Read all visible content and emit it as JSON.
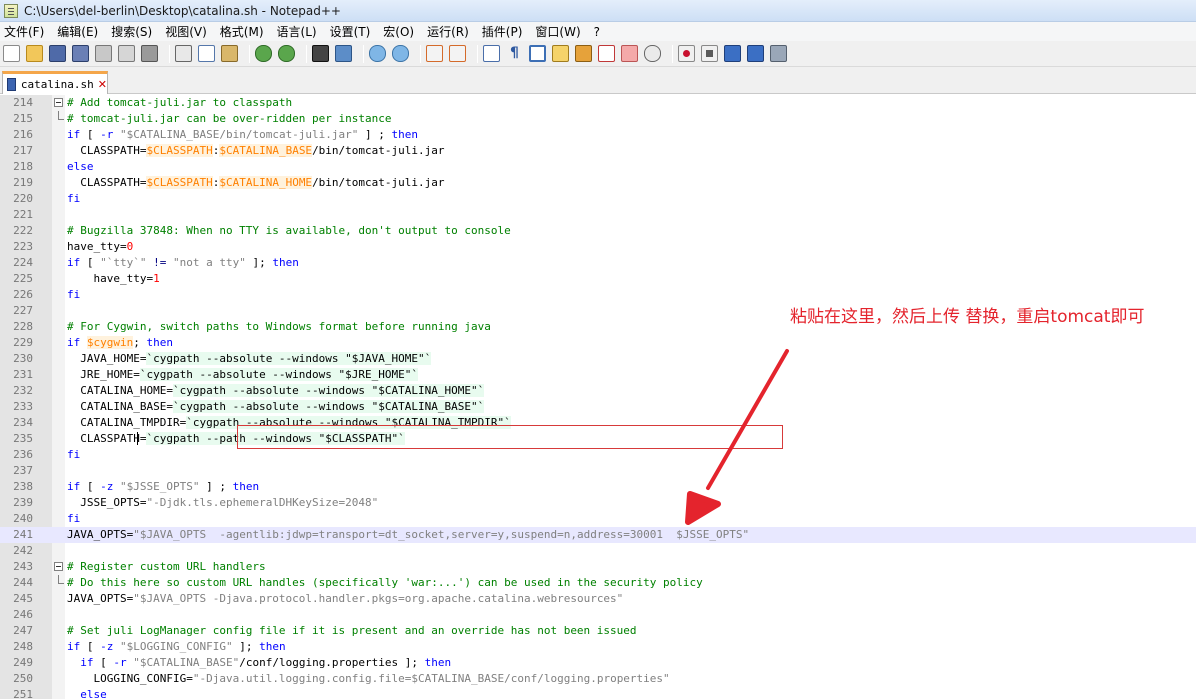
{
  "window": {
    "title": "C:\\Users\\del-berlin\\Desktop\\catalina.sh - Notepad++"
  },
  "menu": [
    "文件(F)",
    "编辑(E)",
    "搜索(S)",
    "视图(V)",
    "格式(M)",
    "语言(L)",
    "设置(T)",
    "宏(O)",
    "运行(R)",
    "插件(P)",
    "窗口(W)",
    "?"
  ],
  "toolbar_icons": [
    "new-file",
    "open-folder",
    "save",
    "save-all",
    "close",
    "close-all",
    "print",
    "|",
    "cut",
    "copy",
    "paste",
    "|",
    "undo",
    "redo",
    "|",
    "find",
    "replace",
    "|",
    "zoom-in",
    "zoom-out",
    "|",
    "sync-v",
    "sync-h",
    "|",
    "wrap",
    "all-chars",
    "indent-guide",
    "lang",
    "doc-map",
    "func-list",
    "folder",
    "monitor",
    "|",
    "rec",
    "stop",
    "play",
    "play-multi",
    "save-macro"
  ],
  "tabs": [
    {
      "label": "catalina.sh",
      "active": true
    }
  ],
  "editor": {
    "caret_line": 241,
    "lines": [
      {
        "n": "214",
        "fold": "start",
        "tokens": [
          [
            "c",
            "# Add tomcat-juli.jar to classpath"
          ]
        ]
      },
      {
        "n": "215",
        "fold": "end",
        "tokens": [
          [
            "c",
            "# tomcat-juli.jar can be over-ridden per instance"
          ]
        ]
      },
      {
        "n": "216",
        "tokens": [
          [
            "k",
            "if"
          ],
          [
            "t",
            " [ "
          ],
          [
            "k",
            "-r"
          ],
          [
            "t",
            " "
          ],
          [
            "s",
            "\"$CATALINA_BASE/bin/tomcat-juli.jar\""
          ],
          [
            "t",
            " ] ; "
          ],
          [
            "k",
            "then"
          ]
        ]
      },
      {
        "n": "217",
        "tokens": [
          [
            "t",
            "  CLASSPATH="
          ],
          [
            "v",
            "$CLASSPATH"
          ],
          [
            "t",
            ":"
          ],
          [
            "v",
            "$CATALINA_BASE"
          ],
          [
            "t",
            "/bin/tomcat-juli.jar"
          ]
        ]
      },
      {
        "n": "218",
        "tokens": [
          [
            "k",
            "else"
          ]
        ]
      },
      {
        "n": "219",
        "tokens": [
          [
            "t",
            "  CLASSPATH="
          ],
          [
            "v",
            "$CLASSPATH"
          ],
          [
            "t",
            ":"
          ],
          [
            "v",
            "$CATALINA_HOME"
          ],
          [
            "t",
            "/bin/tomcat-juli.jar"
          ]
        ]
      },
      {
        "n": "220",
        "tokens": [
          [
            "k",
            "fi"
          ]
        ]
      },
      {
        "n": "221",
        "tokens": []
      },
      {
        "n": "222",
        "tokens": [
          [
            "c",
            "# Bugzilla 37848: When no TTY is available, don't output to console"
          ]
        ]
      },
      {
        "n": "223",
        "tokens": [
          [
            "t",
            "have_tty="
          ],
          [
            "n",
            "0"
          ]
        ]
      },
      {
        "n": "224",
        "tokens": [
          [
            "k",
            "if"
          ],
          [
            "t",
            " [ "
          ],
          [
            "s",
            "\"`tty`\""
          ],
          [
            "t",
            " "
          ],
          [
            "o",
            "!="
          ],
          [
            "t",
            " "
          ],
          [
            "s",
            "\"not a tty\""
          ],
          [
            "t",
            " ]; "
          ],
          [
            "k",
            "then"
          ]
        ]
      },
      {
        "n": "225",
        "tokens": [
          [
            "t",
            "    have_tty="
          ],
          [
            "n",
            "1"
          ]
        ]
      },
      {
        "n": "226",
        "tokens": [
          [
            "k",
            "fi"
          ]
        ]
      },
      {
        "n": "227",
        "tokens": []
      },
      {
        "n": "228",
        "tokens": [
          [
            "c",
            "# For Cygwin, switch paths to Windows format before running java"
          ]
        ]
      },
      {
        "n": "229",
        "tokens": [
          [
            "k",
            "if"
          ],
          [
            "t",
            " "
          ],
          [
            "v",
            "$cygwin"
          ],
          [
            "t",
            "; "
          ],
          [
            "k",
            "then"
          ]
        ]
      },
      {
        "n": "230",
        "tokens": [
          [
            "t",
            "  JAVA_HOME="
          ],
          [
            "b",
            "`cygpath --absolute --windows \"$JAVA_HOME\"`"
          ]
        ]
      },
      {
        "n": "231",
        "tokens": [
          [
            "t",
            "  JRE_HOME="
          ],
          [
            "b",
            "`cygpath --absolute --windows \"$JRE_HOME\"`"
          ]
        ]
      },
      {
        "n": "232",
        "tokens": [
          [
            "t",
            "  CATALINA_HOME="
          ],
          [
            "b",
            "`cygpath --absolute --windows \"$CATALINA_HOME\"`"
          ]
        ]
      },
      {
        "n": "233",
        "tokens": [
          [
            "t",
            "  CATALINA_BASE="
          ],
          [
            "b",
            "`cygpath --absolute --windows \"$CATALINA_BASE\"`"
          ]
        ]
      },
      {
        "n": "234",
        "tokens": [
          [
            "t",
            "  CATALINA_TMPDIR="
          ],
          [
            "b",
            "`cygpath --absolute --windows \"$CATALINA_TMPDIR\"`"
          ]
        ]
      },
      {
        "n": "235",
        "tokens": [
          [
            "t",
            "  CLASSPATH="
          ],
          [
            "b",
            "`cygpath --path --windows \"$CLASSPATH\"`"
          ]
        ]
      },
      {
        "n": "236",
        "tokens": [
          [
            "k",
            "fi"
          ]
        ]
      },
      {
        "n": "237",
        "tokens": []
      },
      {
        "n": "238",
        "tokens": [
          [
            "k",
            "if"
          ],
          [
            "t",
            " [ "
          ],
          [
            "k",
            "-z"
          ],
          [
            "t",
            " "
          ],
          [
            "s",
            "\"$JSSE_OPTS\""
          ],
          [
            "t",
            " ] ; "
          ],
          [
            "k",
            "then"
          ]
        ]
      },
      {
        "n": "239",
        "tokens": [
          [
            "t",
            "  JSSE_OPTS="
          ],
          [
            "s",
            "\"-Djdk.tls.ephemeralDHKeySize=2048\""
          ]
        ]
      },
      {
        "n": "240",
        "tokens": [
          [
            "k",
            "fi"
          ]
        ]
      },
      {
        "n": "241",
        "tokens": [
          [
            "t",
            "JAVA_OPTS="
          ],
          [
            "s",
            "\"$JAVA_OPTS  -agentlib:jdwp=transport=dt_socket,server=y,suspend=n,address=30001  $JSSE_OPTS\""
          ]
        ]
      },
      {
        "n": "242",
        "tokens": []
      },
      {
        "n": "243",
        "fold": "start",
        "tokens": [
          [
            "c",
            "# Register custom URL handlers"
          ]
        ]
      },
      {
        "n": "244",
        "fold": "end",
        "tokens": [
          [
            "c",
            "# Do this here so custom URL handles (specifically 'war:...') can be used in the security policy"
          ]
        ]
      },
      {
        "n": "245",
        "tokens": [
          [
            "t",
            "JAVA_OPTS="
          ],
          [
            "s",
            "\"$JAVA_OPTS -Djava.protocol.handler.pkgs=org.apache.catalina.webresources\""
          ]
        ]
      },
      {
        "n": "246",
        "tokens": []
      },
      {
        "n": "247",
        "tokens": [
          [
            "c",
            "# Set juli LogManager config file if it is present and an override has not been issued"
          ]
        ]
      },
      {
        "n": "248",
        "tokens": [
          [
            "k",
            "if"
          ],
          [
            "t",
            " [ "
          ],
          [
            "k",
            "-z"
          ],
          [
            "t",
            " "
          ],
          [
            "s",
            "\"$LOGGING_CONFIG\""
          ],
          [
            "t",
            " ]; "
          ],
          [
            "k",
            "then"
          ]
        ]
      },
      {
        "n": "249",
        "tokens": [
          [
            "t",
            "  "
          ],
          [
            "k",
            "if"
          ],
          [
            "t",
            " [ "
          ],
          [
            "k",
            "-r"
          ],
          [
            "t",
            " "
          ],
          [
            "s",
            "\"$CATALINA_BASE\""
          ],
          [
            "t",
            "/conf/logging.properties ]; "
          ],
          [
            "k",
            "then"
          ]
        ]
      },
      {
        "n": "250",
        "tokens": [
          [
            "t",
            "    LOGGING_CONFIG="
          ],
          [
            "s",
            "\"-Djava.util.logging.config.file=$CATALINA_BASE/conf/logging.properties\""
          ]
        ]
      },
      {
        "n": "251",
        "tokens": [
          [
            "t",
            "  "
          ],
          [
            "k",
            "else"
          ]
        ]
      }
    ]
  },
  "annotation": {
    "text": "粘贴在这里，然后上传 替换，重启tomcat即可",
    "color": "#e4242d"
  },
  "colors": {
    "comment": "#008000",
    "keyword": "#0000ff",
    "string": "#808080",
    "variable": "#ff8000",
    "caret_line": "#e8e8ff",
    "annotation": "#e4242d"
  }
}
